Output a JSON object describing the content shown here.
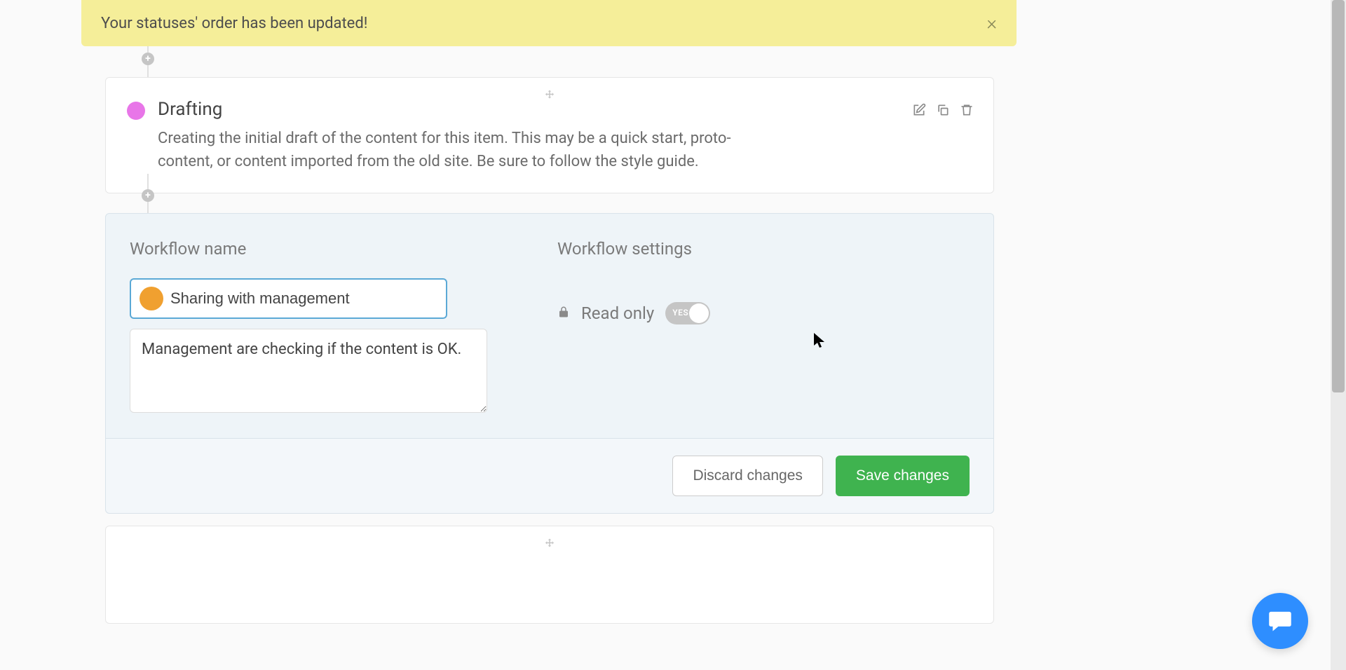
{
  "alert": {
    "message": "Your statuses' order has been updated!"
  },
  "statuses": {
    "drafting": {
      "title": "Drafting",
      "description": "Creating the initial draft of the content for this item. This may be a quick start, proto-content, or content imported from the old site. Be sure to follow the style guide.",
      "color": "#e876e8"
    }
  },
  "editor": {
    "name_label": "Workflow name",
    "settings_label": "Workflow settings",
    "name_value": "Sharing with management",
    "description_value": "Management are checking if the content is OK.",
    "dot_color": "#f0a030",
    "readonly_label": "Read only",
    "toggle_text": "YES",
    "discard_label": "Discard changes",
    "save_label": "Save changes"
  }
}
